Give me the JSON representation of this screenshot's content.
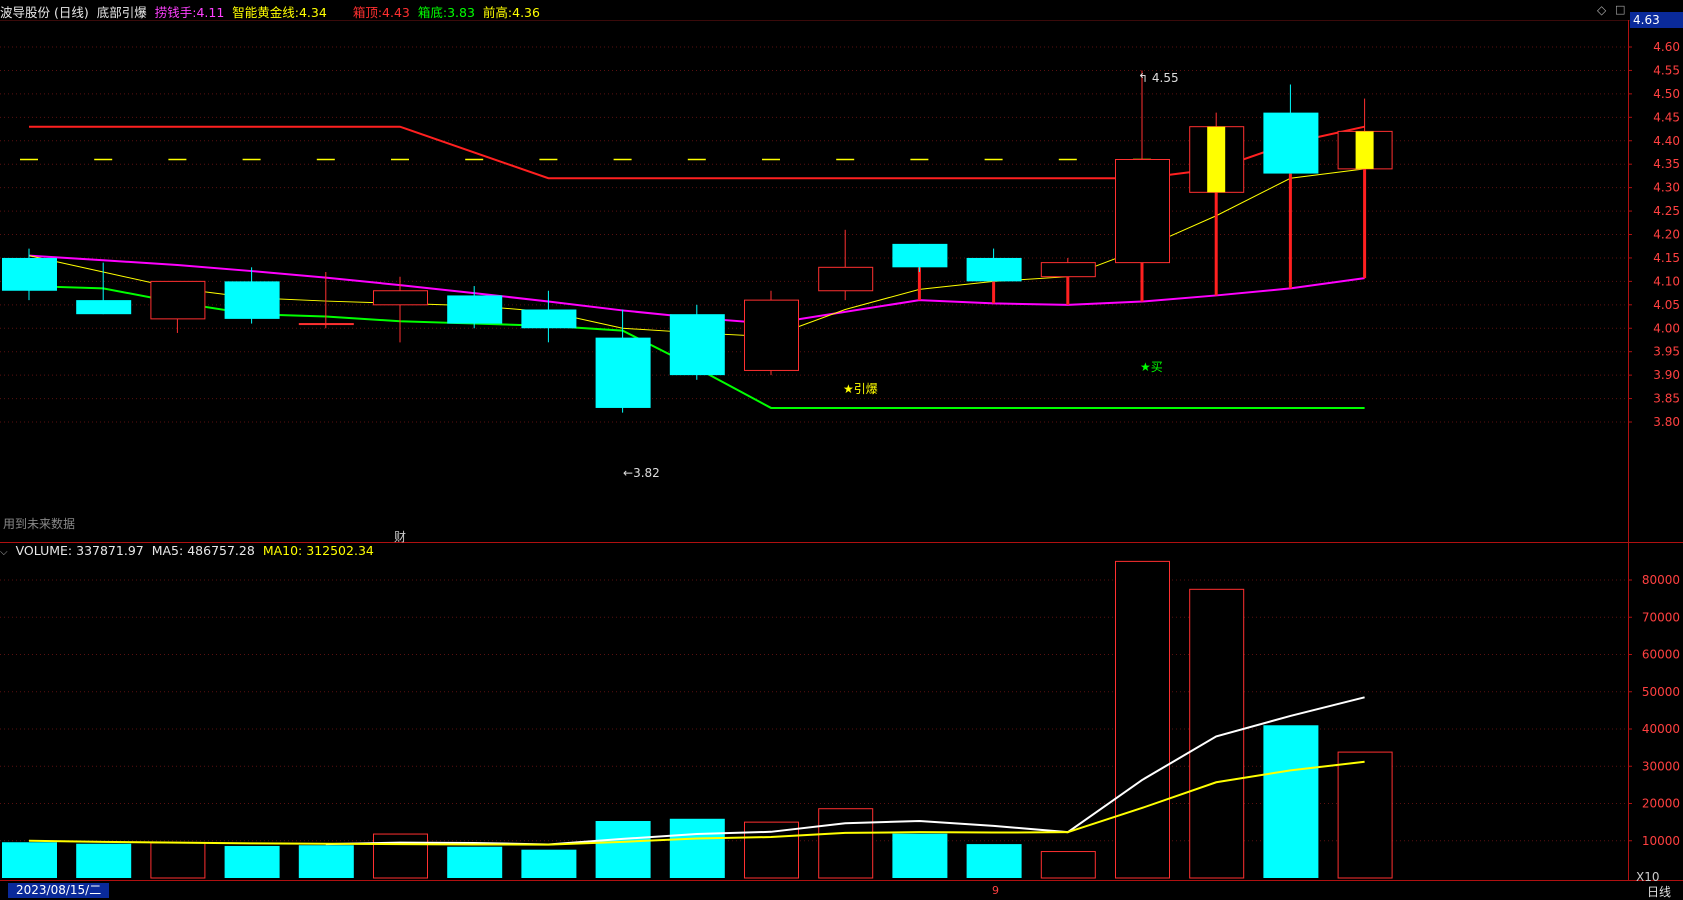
{
  "header": {
    "stock_label": "波导股份 (日线)",
    "indicator_name": "底部引爆",
    "lao_label": "捞钱手:",
    "lao_value": "4.11",
    "gold_label": "智能黄金线:",
    "gold_value": "4.34",
    "top_label": "箱顶:",
    "top_value": "4.43",
    "bottom_label": "箱底:",
    "bottom_value": "3.83",
    "prev_high_label": "前高:",
    "prev_high_value": "4.36"
  },
  "price_panel": {
    "current_price": "4.63",
    "future_data_note": "用到未来数据",
    "finance_marker": "财",
    "annotations": {
      "high": "4.55",
      "low": "3.82",
      "yinbao": "★引爆",
      "buy": "★买"
    }
  },
  "volume_panel": {
    "label": "VOLUME:",
    "value": "337871.97",
    "ma5_label": "MA5:",
    "ma5_value": "486757.28",
    "ma10_label": "MA10:",
    "ma10_value": "312502.34",
    "unit": "X10"
  },
  "footer": {
    "date": "2023/08/15/二",
    "period": "日线",
    "marker": "9"
  },
  "colors": {
    "up": "#ff3030",
    "down": "#00ffff",
    "magenta": "#ff00ff",
    "yellow": "#ffff00",
    "green": "#00ff00",
    "white": "#ffffff",
    "grid": "#5a1010",
    "axis": "#b01010"
  },
  "chart_data": [
    {
      "type": "candlestick",
      "title": "波导股份 (日线)",
      "ylim": [
        3.75,
        4.63
      ],
      "yticks": [
        3.8,
        3.85,
        3.9,
        3.95,
        4.0,
        4.05,
        4.1,
        4.15,
        4.2,
        4.25,
        4.3,
        4.35,
        4.4,
        4.45,
        4.5,
        4.55,
        4.6
      ],
      "candles": [
        {
          "o": 4.15,
          "h": 4.17,
          "l": 4.06,
          "c": 4.08
        },
        {
          "o": 4.06,
          "h": 4.14,
          "l": 4.03,
          "c": 4.03
        },
        {
          "o": 4.02,
          "h": 4.1,
          "l": 3.99,
          "c": 4.1
        },
        {
          "o": 4.1,
          "h": 4.13,
          "l": 4.01,
          "c": 4.02
        },
        {
          "o": 4.01,
          "h": 4.12,
          "l": 4.0,
          "c": 4.01
        },
        {
          "o": 4.05,
          "h": 4.11,
          "l": 3.97,
          "c": 4.08
        },
        {
          "o": 4.07,
          "h": 4.09,
          "l": 4.0,
          "c": 4.01
        },
        {
          "o": 4.04,
          "h": 4.08,
          "l": 3.97,
          "c": 4.0
        },
        {
          "o": 3.98,
          "h": 4.04,
          "l": 3.82,
          "c": 3.83
        },
        {
          "o": 4.03,
          "h": 4.05,
          "l": 3.89,
          "c": 3.9
        },
        {
          "o": 3.91,
          "h": 4.08,
          "l": 3.9,
          "c": 4.06
        },
        {
          "o": 4.08,
          "h": 4.21,
          "l": 4.06,
          "c": 4.13
        },
        {
          "o": 4.18,
          "h": 4.18,
          "l": 4.12,
          "c": 4.13
        },
        {
          "o": 4.15,
          "h": 4.17,
          "l": 4.1,
          "c": 4.1
        },
        {
          "o": 4.11,
          "h": 4.15,
          "l": 4.11,
          "c": 4.14
        },
        {
          "o": 4.14,
          "h": 4.55,
          "l": 4.14,
          "c": 4.36
        },
        {
          "o": 4.29,
          "h": 4.46,
          "l": 4.29,
          "c": 4.43
        },
        {
          "o": 4.46,
          "h": 4.52,
          "l": 4.33,
          "c": 4.33
        },
        {
          "o": 4.34,
          "h": 4.49,
          "l": 4.34,
          "c": 4.42
        }
      ],
      "series": [
        {
          "name": "箱顶",
          "color": "#ff2020",
          "values": [
            4.43,
            4.43,
            4.43,
            4.43,
            4.43,
            4.43,
            null,
            4.32,
            4.32,
            4.32,
            4.32,
            4.32,
            4.32,
            4.32,
            4.32,
            4.32,
            4.34,
            4.395,
            4.43
          ]
        },
        {
          "name": "前高",
          "color": "#ffff00",
          "dash": true,
          "values": [
            4.36,
            4.36,
            4.36,
            4.36,
            4.36,
            4.36,
            4.36,
            4.36,
            4.36,
            4.36,
            4.36,
            4.36,
            4.36,
            4.36,
            4.36,
            4.36,
            4.36,
            4.36,
            null
          ]
        },
        {
          "name": "捞钱手",
          "color": "#ff00ff",
          "values": [
            4.155,
            4.145,
            4.135,
            4.122,
            4.108,
            4.092,
            4.075,
            4.057,
            4.038,
            4.022,
            4.01,
            null,
            4.06,
            4.053,
            4.05,
            4.057,
            4.07,
            4.085,
            4.107
          ]
        },
        {
          "name": "箱底",
          "color": "#00ff00",
          "values": [
            4.09,
            4.085,
            4.055,
            4.03,
            4.025,
            4.015,
            4.01,
            4.005,
            3.995,
            3.915,
            3.83,
            3.83,
            3.83,
            3.83,
            3.83,
            3.83,
            3.83,
            3.83,
            3.83
          ]
        },
        {
          "name": "智能黄金线",
          "color": "#ffff00",
          "values": [
            4.155,
            4.12,
            4.085,
            4.065,
            4.058,
            4.053,
            4.048,
            4.035,
            4.0,
            3.99,
            3.982,
            4.04,
            4.083,
            4.1,
            4.11,
            4.17,
            4.24,
            4.32,
            4.34
          ]
        }
      ],
      "markers": [
        {
          "name": "bar",
          "i": 10,
          "text": "★引爆"
        },
        {
          "name": "bar",
          "i": 15,
          "text": "★买"
        }
      ]
    },
    {
      "type": "bar",
      "title": "VOLUME",
      "ylim": [
        0,
        90000
      ],
      "yticks": [
        10000,
        20000,
        30000,
        40000,
        50000,
        60000,
        70000,
        80000
      ],
      "values": [
        9600,
        9200,
        9400,
        8600,
        8800,
        11800,
        8400,
        7600,
        15300,
        15900,
        15000,
        18600,
        11900,
        9100,
        7100,
        85000,
        77500,
        41000,
        33800
      ],
      "up": [
        false,
        false,
        true,
        false,
        false,
        true,
        false,
        false,
        false,
        false,
        true,
        true,
        false,
        false,
        true,
        true,
        true,
        false,
        true
      ],
      "series": [
        {
          "name": "MA5",
          "color": "#ffffff",
          "values": [
            null,
            null,
            null,
            null,
            9100,
            9500,
            9400,
            9000,
            10500,
            11800,
            12400,
            14700,
            15300,
            14000,
            12300,
            26300,
            38000,
            43500,
            48500
          ]
        },
        {
          "name": "MA10",
          "color": "#ffff00",
          "values": [
            10000,
            9700,
            9500,
            9300,
            9200,
            9100,
            9000,
            8950,
            9700,
            10600,
            11000,
            12100,
            12300,
            12200,
            12300,
            18800,
            25700,
            28900,
            31200
          ]
        }
      ]
    }
  ]
}
